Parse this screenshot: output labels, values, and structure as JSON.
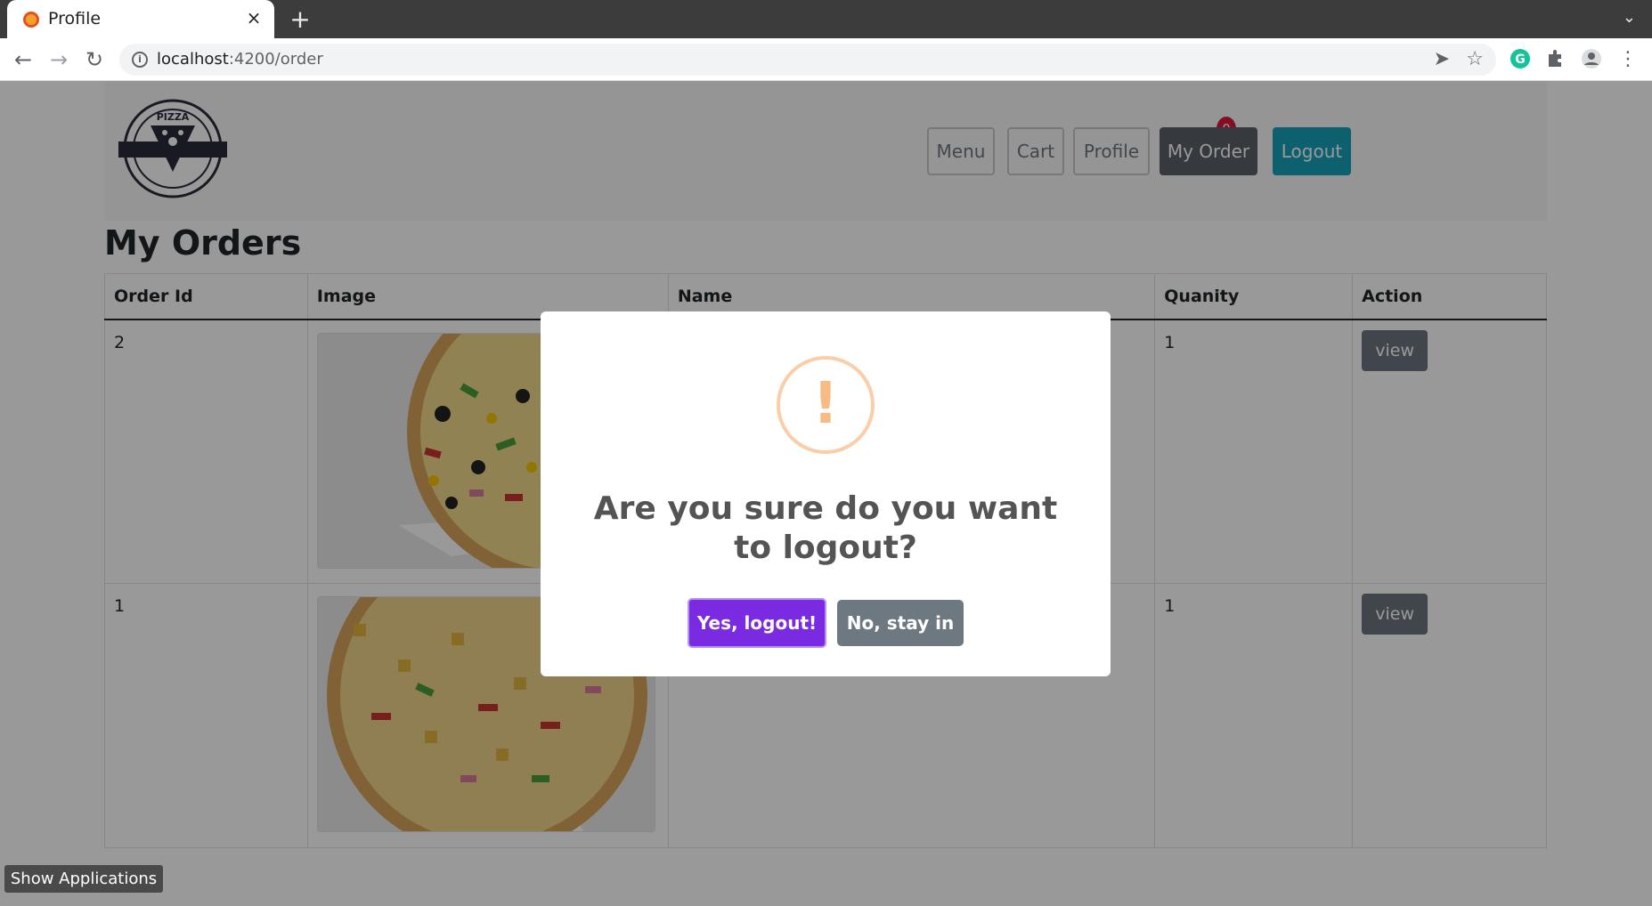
{
  "browser": {
    "tab_title": "Profile",
    "tab_close": "×",
    "new_tab": "+",
    "url_host": "localhost",
    "url_path": ":4200/order"
  },
  "navbar": {
    "menu_label": "Menu",
    "cart_label": "Cart",
    "cart_count": "0",
    "profile_label": "Profile",
    "my_order_label": "My Order",
    "logout_label": "Logout"
  },
  "page": {
    "title": "My Orders"
  },
  "table": {
    "headers": [
      "Order Id",
      "Image",
      "Name",
      "Quanity",
      "Action"
    ],
    "rows": [
      {
        "order_id": "2",
        "quantity": "1",
        "action": "view"
      },
      {
        "order_id": "1",
        "quantity": "1",
        "action": "view"
      }
    ]
  },
  "modal": {
    "icon": "!",
    "title": "Are you sure do you want to logout?",
    "confirm_label": "Yes, logout!",
    "cancel_label": "No, stay in"
  },
  "taskbar": {
    "show_apps_label": "Show Applications"
  },
  "colors": {
    "confirm": "#7a2be2",
    "cancel": "#6e7881",
    "logout": "#17a2b8",
    "badge": "#dc143c",
    "warning": "#f8bb86"
  }
}
